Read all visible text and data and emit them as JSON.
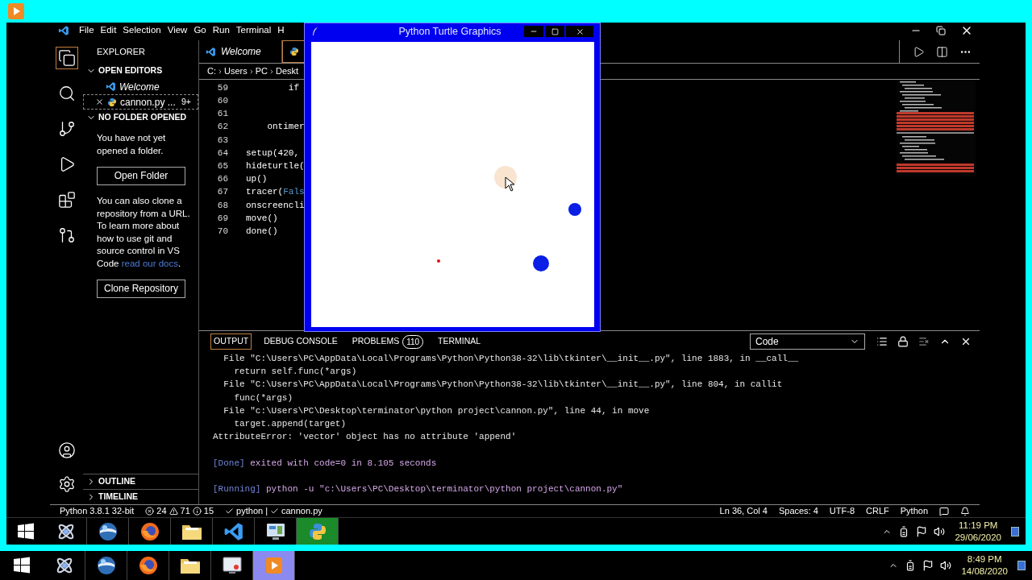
{
  "vscode": {
    "menu": [
      "File",
      "Edit",
      "Selection",
      "View",
      "Go",
      "Run",
      "Terminal",
      "H"
    ]
  },
  "activity_bar": [
    {
      "kind": "explorer",
      "selected": true
    },
    {
      "kind": "search",
      "selected": false
    },
    {
      "kind": "scm",
      "selected": false
    },
    {
      "kind": "debug",
      "selected": false
    },
    {
      "kind": "extensions",
      "selected": false
    },
    {
      "kind": "pr",
      "selected": false
    }
  ],
  "explorer": {
    "title": "EXPLORER",
    "open_editors": {
      "label": "OPEN EDITORS",
      "expanded": true,
      "items": [
        {
          "name": "Welcome",
          "kind": "welcome",
          "selected": false
        },
        {
          "name": "cannon.py ...",
          "badge": "9+",
          "kind": "python",
          "selected": true
        }
      ]
    },
    "no_folder": {
      "label": "NO FOLDER OPENED",
      "expanded": true,
      "message": "You have not yet opened a folder.",
      "open_button": "Open Folder",
      "clone_text": "You can also clone a repository from a URL. To learn more about how to use git and source control in VS Code ",
      "clone_link": "read our docs",
      "clone_end": ".",
      "clone_button": "Clone Repository"
    },
    "collapsed_sections": [
      {
        "label": "OUTLINE",
        "expanded": false
      },
      {
        "label": "TIMELINE",
        "expanded": false
      }
    ]
  },
  "editor_tabs": [
    {
      "label": "Welcome",
      "kind": "welcome",
      "selected": false
    },
    {
      "kind": "python",
      "selected": true
    }
  ],
  "breadcrumb": [
    "C:",
    "Users",
    "PC",
    "Deskt"
  ],
  "code_lines": [
    {
      "number": "59",
      "tokens": [
        {
          "text": "        if",
          "kind": "plain"
        }
      ]
    },
    {
      "number": "60"
    },
    {
      "number": "61"
    },
    {
      "number": "62",
      "tokens": [
        {
          "text": "    ontimer",
          "kind": "plain"
        }
      ]
    },
    {
      "number": "63"
    },
    {
      "number": "64",
      "tokens": [
        {
          "text": "setup(420,",
          "kind": "plain"
        }
      ]
    },
    {
      "number": "65",
      "tokens": [
        {
          "text": "hideturtle(",
          "kind": "plain"
        }
      ]
    },
    {
      "number": "66",
      "tokens": [
        {
          "text": "up()",
          "kind": "plain"
        }
      ]
    },
    {
      "number": "67",
      "tokens": [
        {
          "text": "tracer(",
          "kind": "plain"
        },
        {
          "text": "Fals",
          "kind": "constant"
        }
      ]
    },
    {
      "number": "68",
      "tokens": [
        {
          "text": "onscreencli",
          "kind": "plain"
        }
      ]
    },
    {
      "number": "69",
      "tokens": [
        {
          "text": "move()",
          "kind": "plain"
        }
      ]
    },
    {
      "number": "70",
      "tokens": [
        {
          "text": "done()",
          "kind": "plain"
        }
      ]
    }
  ],
  "panel": {
    "tabs": [
      {
        "label": "OUTPUT",
        "selected": true
      },
      {
        "label": "DEBUG CONSOLE",
        "selected": false
      },
      {
        "label": "PROBLEMS",
        "badge": "110",
        "selected": false
      },
      {
        "label": "TERMINAL",
        "selected": false
      }
    ],
    "channel_select": "Code",
    "output_blocks": [
      [
        {
          "kind": "plain",
          "text": "  File \"C:\\Users\\PC\\AppData\\Local\\Programs\\Python\\Python38-32\\lib\\tkinter\\__init__.py\", line 1883, in __call__"
        },
        {
          "kind": "plain",
          "text": "    return self.func(*args)"
        },
        {
          "kind": "plain",
          "text": "  File \"C:\\Users\\PC\\AppData\\Local\\Programs\\Python\\Python38-32\\lib\\tkinter\\__init__.py\", line 804, in callit"
        },
        {
          "kind": "plain",
          "text": "    func(*args)"
        },
        {
          "kind": "plain",
          "text": "  File \"c:\\Users\\PC\\Desktop\\terminator\\python project\\cannon.py\", line 44, in move"
        },
        {
          "kind": "plain",
          "text": "    target.append(target)"
        },
        {
          "kind": "plain",
          "text": "AttributeError: 'vector' object has no attribute 'append'"
        }
      ],
      [
        {
          "kind": "status",
          "tag": "[Done]",
          "text": " exited with code=0 in 8.105 seconds"
        }
      ],
      [
        {
          "kind": "status",
          "tag": "[Running]",
          "text": " python -u \"c:\\Users\\PC\\Desktop\\terminator\\python project\\cannon.py\""
        }
      ]
    ]
  },
  "status_bar": {
    "interpreter": "Python 3.8.1 32-bit",
    "errors": "24",
    "warnings": "71",
    "infos": "15",
    "linters": [
      "python",
      "cannon.py"
    ],
    "separator": "|",
    "right": [
      "Ln 36, Col 4",
      "Spaces: 4",
      "UTF-8",
      "CRLF",
      "Python"
    ]
  },
  "turtle_window": {
    "title": "Python Turtle Graphics"
  },
  "inner_taskbar": {
    "apps": [
      {
        "kind": "atom",
        "selected": false
      },
      {
        "kind": "globe",
        "selected": false
      },
      {
        "kind": "firefox",
        "selected": false
      },
      {
        "kind": "folder",
        "selected": false
      },
      {
        "kind": "vscode",
        "selected": false
      },
      {
        "kind": "monitor",
        "selected": false
      },
      {
        "kind": "python",
        "selected": true
      }
    ],
    "time": "11:19 PM",
    "date": "29/06/2020"
  },
  "host_taskbar": {
    "apps": [
      {
        "kind": "atom",
        "selected": false
      },
      {
        "kind": "globe",
        "selected": false
      },
      {
        "kind": "firefox",
        "selected": false
      },
      {
        "kind": "folder",
        "selected": false
      },
      {
        "kind": "record",
        "selected": false
      },
      {
        "kind": "player",
        "selected": true
      }
    ],
    "time": "8:49 PM",
    "date": "14/08/2020"
  }
}
